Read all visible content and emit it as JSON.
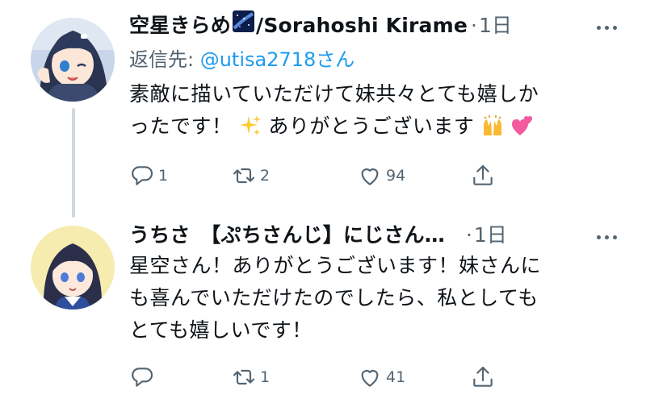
{
  "tweets": [
    {
      "name": "空星きらめ",
      "name_suffix": "/Sorahoshi Kirame",
      "time": "1日",
      "reply_to_label": "返信先: ",
      "reply_to_handle": "@utisa2718さん",
      "text_line1": "素敵に描いていただけて妹共々とても嬉しか",
      "text_line2_a": "ったです！",
      "text_line2_b": "ありがとうございます",
      "replies": "1",
      "retweets": "2",
      "likes": "94"
    },
    {
      "name": "うちさ　【ぷちさんじ】にじさん…",
      "time": "1日",
      "text_line1": "星空さん！ありがとうございます！妹さんに",
      "text_line2": "も喜んでいただけたのでしたら、私としても",
      "text_line3": "とても嬉しいです！",
      "replies": "",
      "retweets": "1",
      "likes": "41"
    }
  ],
  "colors": {
    "secondary": "#536471",
    "link": "#1d9bf0",
    "thread_line": "#cfd9de"
  }
}
